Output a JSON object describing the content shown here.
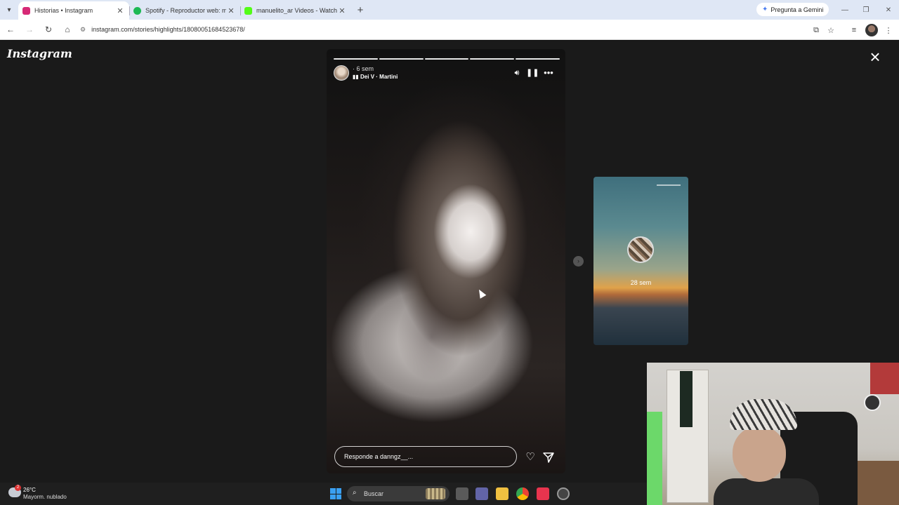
{
  "browser": {
    "tabs": [
      {
        "label": "Historias • Instagram",
        "active": true,
        "favicon_color": "#d62976"
      },
      {
        "label": "Spotify - Reproductor web: mú",
        "active": false,
        "favicon_color": "#1db954"
      },
      {
        "label": "manuelito_ar Videos - Watch O",
        "active": false,
        "favicon_color": "#53fc18"
      }
    ],
    "gemini_label": "Pregunta a Gemini",
    "url": "instagram.com/stories/highlights/18080051684523678/"
  },
  "instagram": {
    "logo": "Instagram",
    "story": {
      "time": "6 sem",
      "song": "Dei V · Martini",
      "reply_placeholder": "Responde a danngz__...",
      "progress_total": 5,
      "progress_done": 5
    },
    "next_story": {
      "time": "28 sem"
    }
  },
  "taskbar": {
    "weather_badge": "2",
    "temperature": "26°C",
    "weather_desc": "Mayorm. nublado",
    "search_placeholder": "Buscar"
  },
  "colors": {
    "tabbar_bg": "#dfe7f5",
    "page_bg": "#1a1a1a",
    "windows_blue": "#3aa0f2"
  }
}
